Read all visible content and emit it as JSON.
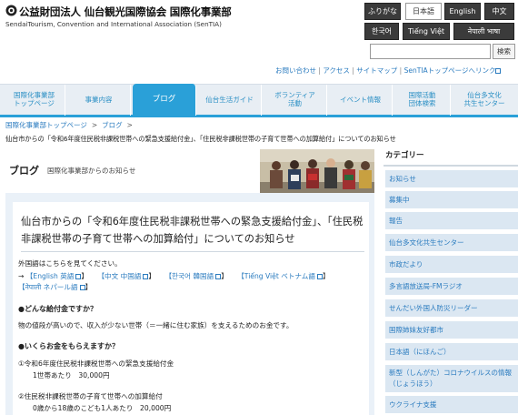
{
  "header": {
    "org_title": "公益財団法人 仙台観光国際協会 国際化事業部",
    "org_subtitle": "SendaiTourism, Convention and International Association (SenTIA)",
    "languages": [
      "ふりがな",
      "日本語",
      "English",
      "中文",
      "한국어",
      "Tiếng Việt",
      "नेपाली भाषा"
    ],
    "active_language": "日本語",
    "search_button": "検索",
    "search_placeholder": "",
    "utility_links": [
      "お問い合わせ",
      "アクセス",
      "サイトマップ",
      "SenTIAトップページへリンク"
    ],
    "utility_sep": "|"
  },
  "nav": {
    "items": [
      "国際化事業部\nトップページ",
      "事業内容",
      "ブログ",
      "仙台生活ガイド",
      "ボランティア\n活動",
      "イベント情報",
      "国際活動\n団体検索",
      "仙台多文化\n共生センター"
    ],
    "active": "ブログ"
  },
  "breadcrumb": [
    "国際化事業部トップページ",
    "ブログ"
  ],
  "breadcrumb_sep": ">",
  "page_desc": "仙台市からの「令和6年度住民税非課税世帯への緊急支援給付金」、「住民税非課税世帯の子育て世帯への加算給付」についてのお知らせ",
  "blog": {
    "title": "ブログ",
    "subtitle": "国際化事業部からのお知らせ"
  },
  "article": {
    "title": "仙台市からの「令和6年度住民税非課税世帯への緊急支援給付金」、「住民税非課税世帯の子育て世帯への加算給付」についてのお知らせ",
    "foreign_lang_intro": "外国語はこちらを見てください。",
    "arrow": "→",
    "lang_links": [
      "【English 英語",
      "【中文 中国語",
      "【한국어 韓国語",
      "【Tiếng Việt ベトナム語",
      "【नेपाली ネパール語"
    ],
    "bracket_close": "】",
    "q1": "●どんな給付金ですか？",
    "a1": "物の値段が高いので、収入が少ない世帯（＝一緒に住む家族）を支えるためのお金です。",
    "q2": "●いくらお金をもらえますか？",
    "item1_title": "①令和6年度住民税非課税世帯への緊急支援給付金",
    "item1_amount": "1世帯あたり　30,000円",
    "item2_title": "②住民税非課税世帯の子育て世帯への加算給付",
    "item2_amount": "0歳から18歳のこども1人あたり　20,000円"
  },
  "sidebar": {
    "heading": "カテゴリー",
    "items": [
      "お知らせ",
      "募集中",
      "報告",
      "仙台多文化共生センター",
      "市政だより",
      "多言語放送局-FMラジオ",
      "せんだい外国人防災リーダー",
      "国際姉妹友好都市",
      "日本語（にほんご）",
      "新型（しんがた）コロナウイルスの情報（じょうほう）",
      "ウクライナ支援"
    ]
  },
  "colors": {
    "accent": "#2aa0d8",
    "link": "#2a7bbf",
    "nav_bg": "#e8eef4",
    "sidebar_item_bg": "#dbe7f2"
  }
}
